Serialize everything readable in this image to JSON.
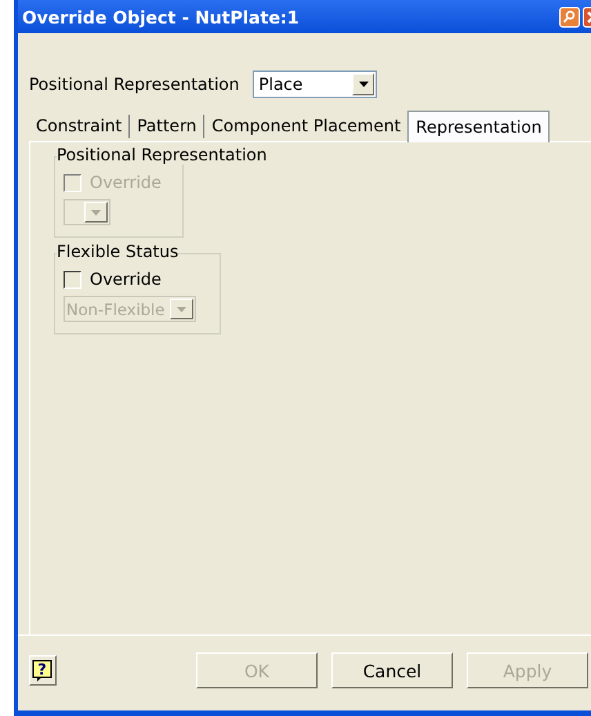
{
  "window": {
    "title": "Override Object - NutPlate:1"
  },
  "positional_representation": {
    "label": "Positional Representation",
    "value": "Place"
  },
  "tabs": [
    {
      "label": "Constraint",
      "selected": false
    },
    {
      "label": "Pattern",
      "selected": false
    },
    {
      "label": "Component Placement",
      "selected": false
    },
    {
      "label": "Representation",
      "selected": true
    }
  ],
  "groups": [
    {
      "title": "Positional Representation",
      "override": {
        "label": "Override",
        "checked": false,
        "disabled": true
      },
      "dropdown": {
        "disabled": true
      }
    },
    {
      "title": "Flexible Status",
      "override": {
        "label": "Override",
        "checked": false,
        "disabled": false
      },
      "dropdown": {
        "value": "Non-Flexible",
        "disabled": true
      }
    }
  ],
  "help_button": {
    "glyph": "?"
  },
  "buttons": [
    {
      "label": "OK",
      "disabled": true
    },
    {
      "label": "Cancel",
      "disabled": false
    },
    {
      "label": "Apply",
      "disabled": true
    }
  ]
}
